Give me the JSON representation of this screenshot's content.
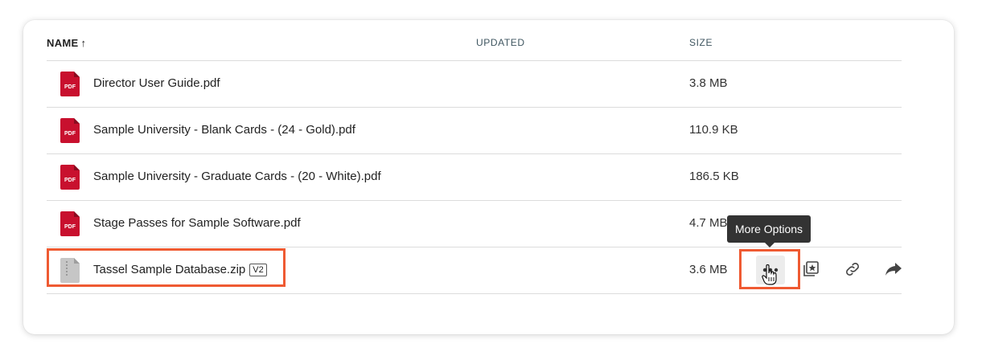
{
  "columns": {
    "name": "NAME",
    "name_sort_icon": "arrow-up-icon",
    "updated": "UPDATED",
    "size": "SIZE"
  },
  "files": [
    {
      "name": "Director User Guide.pdf",
      "type": "pdf",
      "size": "3.8 MB",
      "icon_label": "PDF"
    },
    {
      "name": "Sample University - Blank Cards - (24 - Gold).pdf",
      "type": "pdf",
      "size": "110.9 KB",
      "icon_label": "PDF"
    },
    {
      "name": "Sample University - Graduate Cards - (20 - White).pdf",
      "type": "pdf",
      "size": "186.5 KB",
      "icon_label": "PDF"
    },
    {
      "name": "Stage Passes for Sample Software.pdf",
      "type": "pdf",
      "size": "4.7 MB",
      "icon_label": "PDF"
    },
    {
      "name": "Tassel Sample Database.zip",
      "type": "zip",
      "size": "3.6 MB",
      "version": "V2"
    }
  ],
  "tooltip": "More Options",
  "actions": [
    "more-options-icon",
    "add-to-collection-icon",
    "link-icon",
    "share-icon"
  ],
  "colors": {
    "pdf_red": "#c8102e",
    "highlight": "#ef5a32",
    "tooltip_bg": "#333333"
  }
}
